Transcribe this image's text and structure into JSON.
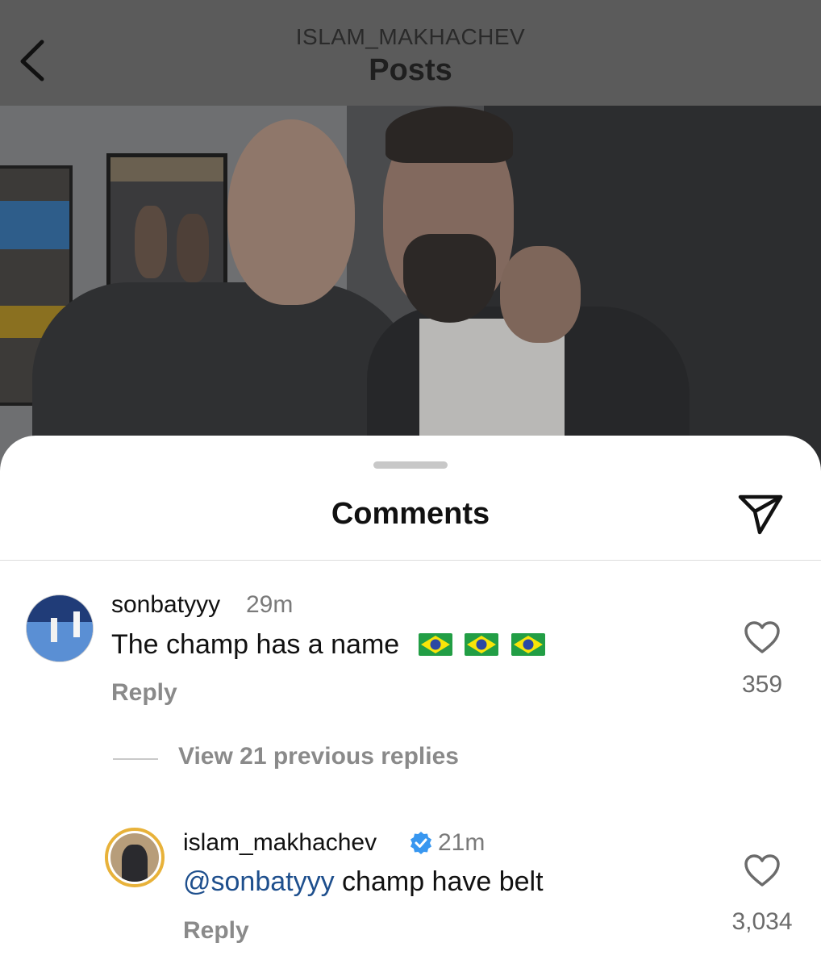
{
  "header": {
    "username": "ISLAM_MAKHACHEV",
    "title": "Posts"
  },
  "sheet": {
    "title": "Comments"
  },
  "comments": [
    {
      "username": "sonbatyyy",
      "time": "29m",
      "text": "The champ has a name",
      "flags": [
        "brazil-flag",
        "brazil-flag",
        "brazil-flag"
      ],
      "reply_label": "Reply",
      "likes": "359"
    }
  ],
  "view_replies": "View 21 previous replies",
  "reply": {
    "username": "islam_makhachev",
    "verified": true,
    "time": "21m",
    "mention": "@sonbatyyy",
    "text": " champ have belt",
    "reply_label": "Reply",
    "likes": "3,034"
  },
  "colors": {
    "topbar": "#5b5b5b",
    "mention": "#1e4f8d",
    "verified": "#3897f0",
    "story_ring": "#e8b23a"
  }
}
